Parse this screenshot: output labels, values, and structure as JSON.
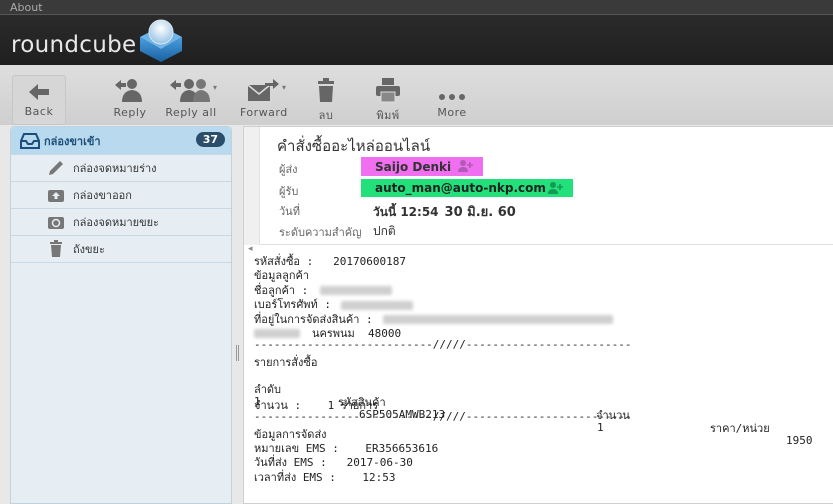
{
  "topbar": {
    "about": "About"
  },
  "header": {
    "logo": "roundcube"
  },
  "toolbar": {
    "back": "Back",
    "reply": "Reply",
    "reply_all": "Reply all",
    "forward": "Forward",
    "delete": "ลบ",
    "print": "พิมพ์",
    "more": "More"
  },
  "sidebar": {
    "folders": [
      {
        "name": "กล่องขาเข้า",
        "count": "37"
      },
      {
        "name": "กล่องจดหมายร่าง"
      },
      {
        "name": "กล่องขาออก"
      },
      {
        "name": "กล่องจดหมายขยะ"
      },
      {
        "name": "ถังขยะ"
      }
    ]
  },
  "message": {
    "subject": "คำสั่งซื้ออะไหล่ออนไลน์",
    "from_label": "ผู้ส่ง",
    "from": "Saijo Denki",
    "to_label": "ผู้รับ",
    "to": "auto_man@auto-nkp.com",
    "date_label": "วันที่",
    "date_prefix": "วันนี้ 12:54",
    "date_big": "30 มิ.ย. 60",
    "priority_label": "ระดับความสำคัญ",
    "priority": "ปกติ",
    "body": {
      "order_label": "รหัสสั่งซื้อ :   20170600187",
      "customer_info": "ข้อมูลลูกค้า",
      "customer_name": "ชื่อลูกค้า :",
      "phone": "เบอร์โทรศัพท์ :",
      "address": "ที่อยู่ในการจัดส่งสินค้า :",
      "province": "นครพนม  48000",
      "divider1": "---------------------------/////-------------------------",
      "items_title": "รายการสั่งซื้อ",
      "col_no": "ลำดับ",
      "col_code": "รหัสสินค้า",
      "col_qty": "จำนวน",
      "col_price": "ราคา/หน่วย",
      "row_no": "1",
      "row_code": "6SP505AMWB213",
      "row_qty": "1",
      "row_price": "1950",
      "total_qty": "จำนวน :    1 รายการ",
      "divider2": "---------------------------/////-------------------------",
      "ship_title": "ข้อมูลการจัดส่ง",
      "ems_no": "หมายเลข EMS :    ER356653616",
      "ems_date": "วันที่ส่ง EMS :   2017-06-30",
      "ems_time": "เวลาที่ส่ง EMS :    12:53"
    }
  },
  "colors": {
    "from_highlight": "#ef6ff0",
    "to_highlight": "#22e07a",
    "badge": "#2a4d6a",
    "inbox_selected": "#b9d9ee"
  }
}
